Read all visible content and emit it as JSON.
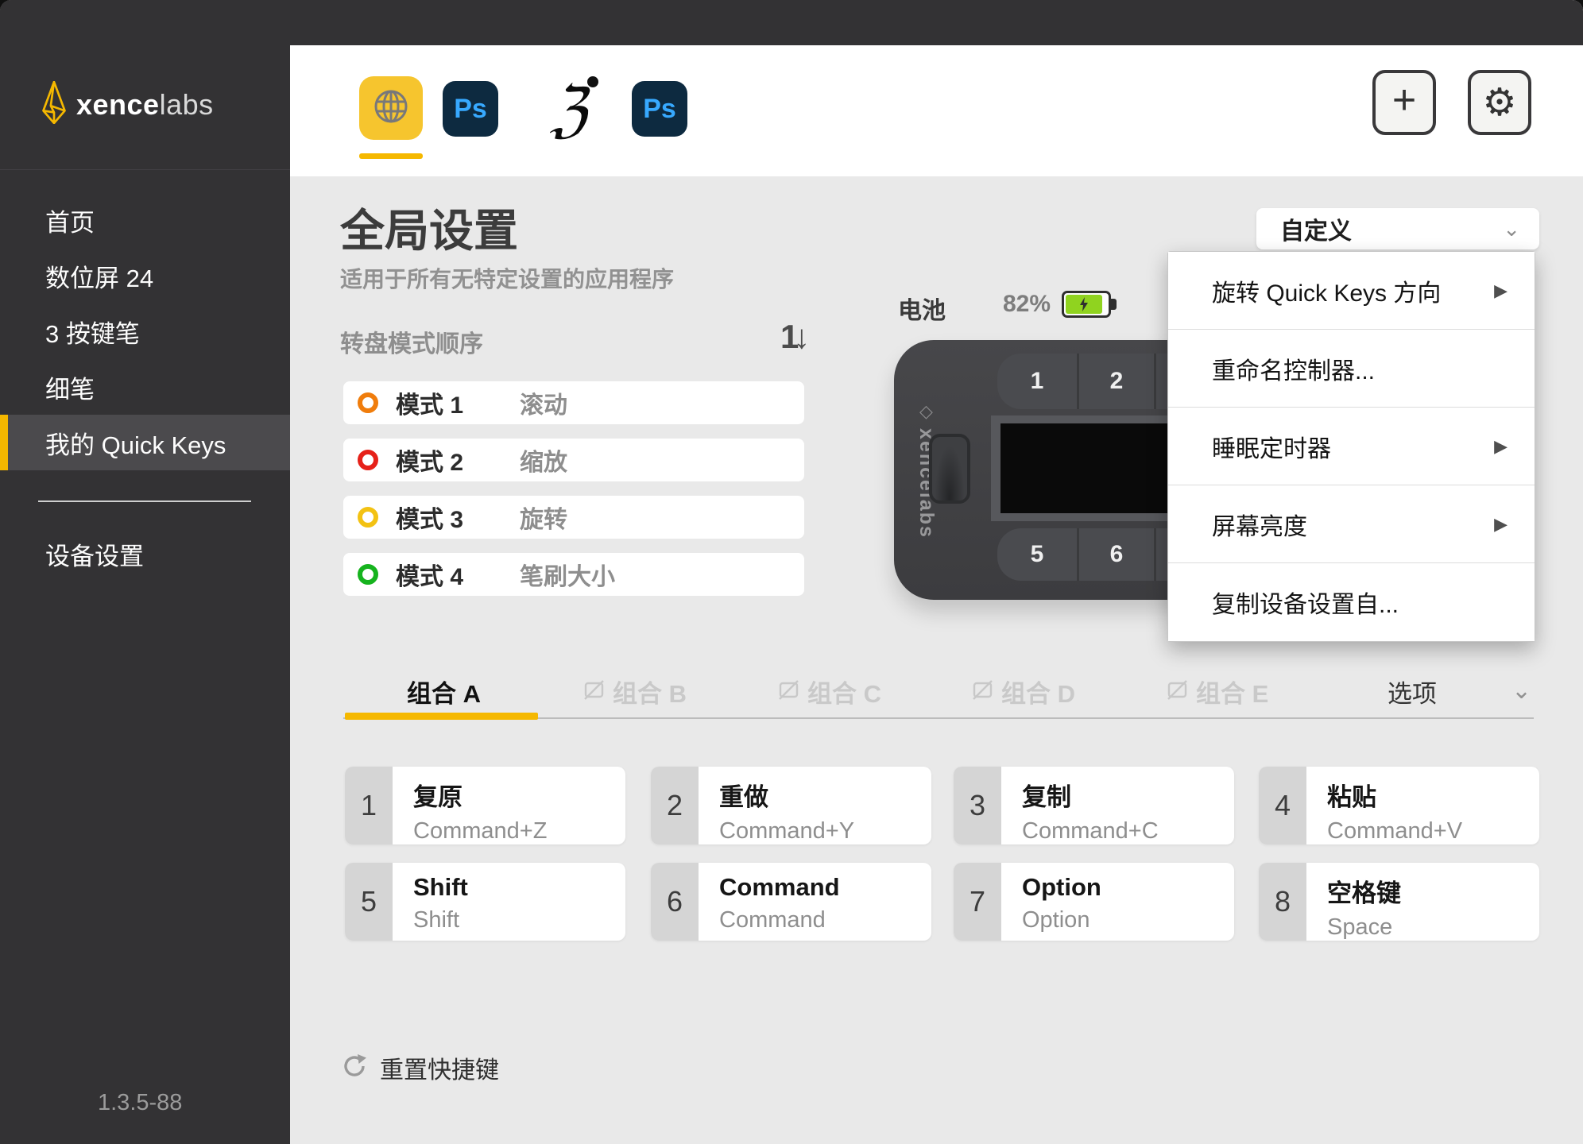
{
  "brand": {
    "bold": "xence",
    "light": "labs"
  },
  "sidebar": {
    "items": [
      {
        "label": "首页"
      },
      {
        "label": "数位屏 24"
      },
      {
        "label": "3 按键笔"
      },
      {
        "label": "细笔"
      },
      {
        "label": "我的 Quick Keys"
      }
    ],
    "device_settings": "设备设置",
    "version": "1.3.5-88"
  },
  "topbar": {
    "apps": {
      "photoshop_label": "Ps",
      "photoshop2_label": "Ps",
      "zbrush_glyph": "ℨ"
    },
    "add_label": "+",
    "gear_glyph": "⚙"
  },
  "main": {
    "title": "全局设置",
    "subtitle": "适用于所有无特定设置的应用程序",
    "preset": {
      "value": "自定义",
      "chevron": "⌄"
    },
    "menu": {
      "arrow": "▶",
      "items": [
        {
          "label": "旋转 Quick Keys 方向",
          "submenu": true
        },
        {
          "label": "重命名控制器...",
          "submenu": false
        },
        {
          "label": "睡眠定时器",
          "submenu": true
        },
        {
          "label": "屏幕亮度",
          "submenu": true
        },
        {
          "label": "复制设备设置自...",
          "submenu": false
        }
      ]
    },
    "battery": {
      "label": "电池",
      "percent": "82%",
      "fill_width": "82%"
    },
    "dial": {
      "header": "转盘模式顺序",
      "sort_icon": "1↓",
      "modes": [
        {
          "name": "模式 1",
          "action": "滚动",
          "color": "#f07d0c"
        },
        {
          "name": "模式 2",
          "action": "缩放",
          "color": "#e62119"
        },
        {
          "name": "模式 3",
          "action": "旋转",
          "color": "#f3c213"
        },
        {
          "name": "模式 4",
          "action": "笔刷大小",
          "color": "#16b31e"
        }
      ]
    },
    "device": {
      "brand": "xencelabs",
      "mark": "◇",
      "top_buttons": [
        "1",
        "2"
      ],
      "bottom_buttons": [
        "5",
        "6"
      ]
    },
    "tabs": {
      "active": "组合 A",
      "inactive": [
        "组合 B",
        "组合 C",
        "组合 D",
        "组合 E"
      ],
      "options": "选项",
      "chevron": "⌄"
    },
    "keys": [
      {
        "num": "1",
        "title": "复原",
        "sub": "Command+Z"
      },
      {
        "num": "2",
        "title": "重做",
        "sub": "Command+Y"
      },
      {
        "num": "3",
        "title": "复制",
        "sub": "Command+C"
      },
      {
        "num": "4",
        "title": "粘贴",
        "sub": "Command+V"
      },
      {
        "num": "5",
        "title": "Shift",
        "sub": "Shift"
      },
      {
        "num": "6",
        "title": "Command",
        "sub": "Command"
      },
      {
        "num": "7",
        "title": "Option",
        "sub": "Option"
      },
      {
        "num": "8",
        "title": "空格键",
        "sub": "Space"
      }
    ],
    "reset_label": "重置快捷键"
  },
  "colors": {
    "accent": "#f5b800",
    "battery_green": "#90d31f",
    "sidebar_bg": "#333234"
  }
}
